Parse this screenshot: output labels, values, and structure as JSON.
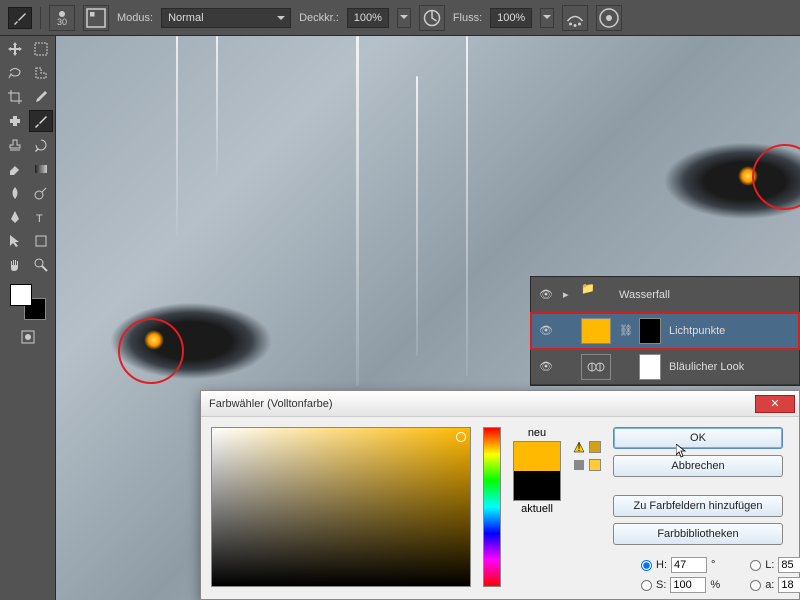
{
  "optbar": {
    "brush_size": "30",
    "modus_label": "Modus:",
    "modus_value": "Normal",
    "deckkr_label": "Deckkr.:",
    "deckkr_value": "100%",
    "fluss_label": "Fluss:",
    "fluss_value": "100%"
  },
  "tools": {
    "fg_color": "#ffffff",
    "bg_color": "#000000"
  },
  "layers": {
    "items": [
      {
        "name": "Wasserfall",
        "type": "group"
      },
      {
        "name": "Lichtpunkte",
        "type": "solid",
        "thumb": "#ffb900",
        "mask": "#000000",
        "selected": true
      },
      {
        "name": "Bläulicher Look",
        "type": "adj",
        "thumb": "balance",
        "mask": "#ffffff"
      }
    ]
  },
  "dialog": {
    "title": "Farbwähler (Volltonfarbe)",
    "neu": "neu",
    "aktuell": "aktuell",
    "ok": "OK",
    "cancel": "Abbrechen",
    "add_swatch": "Zu Farbfeldern hinzufügen",
    "libraries": "Farbbibliotheken",
    "H_label": "H:",
    "H_value": "47",
    "H_unit": "°",
    "S_label": "S:",
    "S_value": "100",
    "S_unit": "%",
    "L_label": "L:",
    "L_value": "85",
    "a_label": "a:",
    "a_value": "18",
    "new_color": "#ffb900",
    "current_color": "#000000"
  }
}
